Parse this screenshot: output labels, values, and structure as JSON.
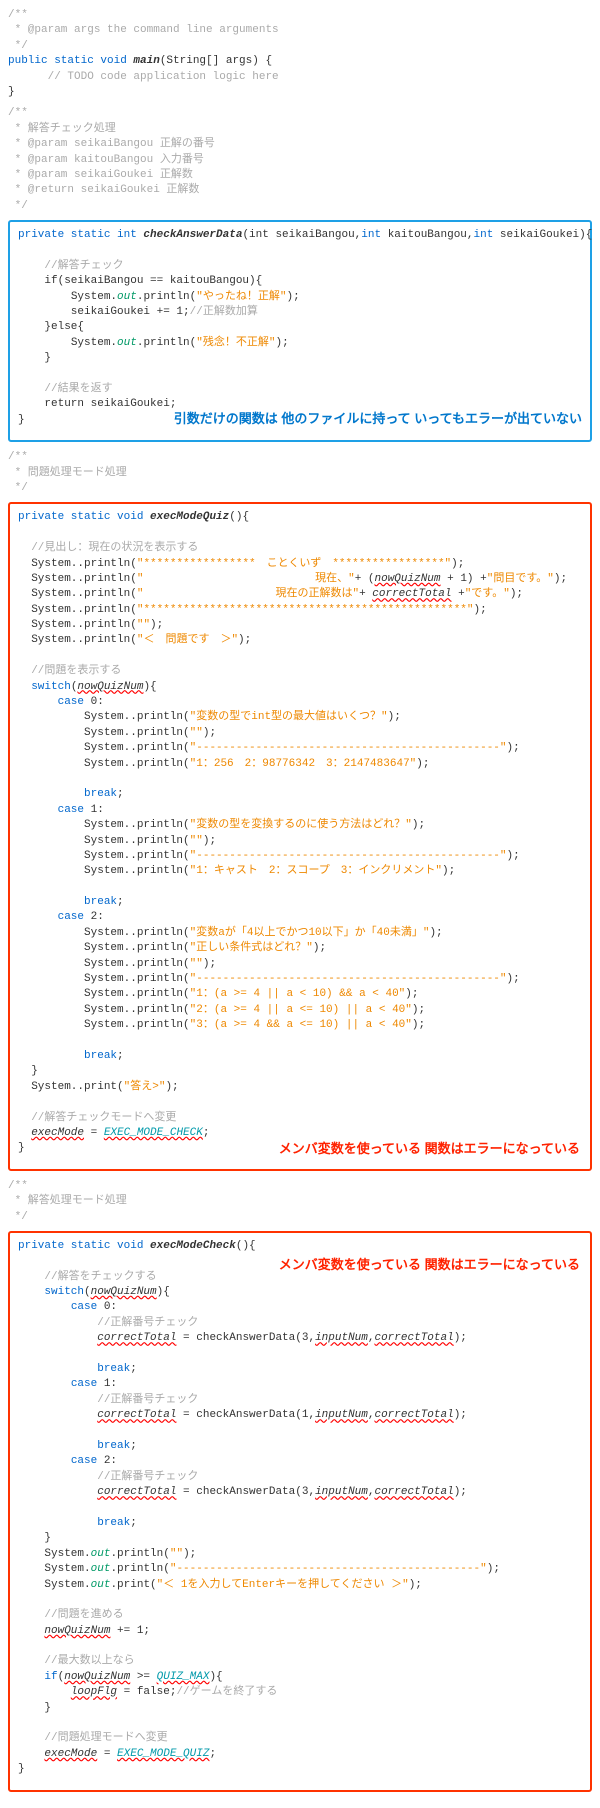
{
  "javadoc_main": {
    "l1": "/**",
    "l2": " * @param args the command line arguments",
    "l3": " */"
  },
  "main_method": {
    "sig_pre": "public static void ",
    "name": "main",
    "sig_post": "(String[] args) {",
    "body": "      // TODO code application logic here",
    "close": "}"
  },
  "javadoc_check": {
    "l1": "/**",
    "l2": " * 解答チェック処理",
    "l3": " * @param seikaiBangou 正解の番号",
    "l4": " * @param kaitouBangou 入力番号",
    "l5": " * @param seikaiGoukei 正解数",
    "l6": " * @return seikaiGoukei 正解数",
    "l7": " */"
  },
  "check_method": {
    "sig_pre": "private static int ",
    "name": "checkAnswerData",
    "sig_post_a": "(int seikaiBangou,",
    "sig_post_b": "int",
    "sig_post_c": " kaitouBangou,",
    "sig_post_d": " seikaiGoukei){",
    "c1": "    //解答チェック",
    "if": "    if(seikaiBangou == kaitouBangou){",
    "sys": "System",
    "out": "out",
    "println": "println",
    "s1": "\"やったね！正解\"",
    "inc": "        seikaiGoukei += 1;",
    "inc_c": "//正解数加算",
    "else": "    }else{",
    "s2": "\"残念！不正解\"",
    "close_if": "    }",
    "c2": "    //結果を返す",
    "ret": "    return seikaiGoukei;",
    "close": "}"
  },
  "annotation_blue": "引数だけの関数は\n他のファイルに持って\nいってもエラーが出ていない",
  "javadoc_quiz": {
    "l1": "/**",
    "l2": " * 問題処理モード処理",
    "l3": " */"
  },
  "quiz_method": {
    "sig_pre": "private static void ",
    "name": "execModeQuiz",
    "sig_post": "(){",
    "c1": "  //見出し：現在の状況を表示する",
    "s1": "\"*****************　ことくいず　*****************\"",
    "s2a": "\"                          現在、\"",
    "s2b": "+ (",
    "s2v": "nowQuizNum",
    "s2c": " + 1) +",
    "s2d": "\"問目です。\"",
    "s3a": "\"                    現在の正解数は\"",
    "s3b": "+ ",
    "s3v": "correctTotal",
    "s3c": " +",
    "s3d": "\"です。\"",
    "s4": "\"*************************************************\"",
    "s5": "\"\"",
    "s6": "\"＜　問題です　＞\"",
    "c2": "  //問題を表示する",
    "sw": "switch",
    "sw_var": "nowQuizNum",
    "case": "case",
    "c0": " 0:",
    "c1n": " 1:",
    "c2n": " 2:",
    "q0_1": "\"変数の型でint型の最大値はいくつ？\"",
    "q0_2": "\"\"",
    "q0_3": "\"----------------------------------------------\"",
    "q0_4": "\"1：256　2：98776342　3：2147483647\"",
    "q1_1": "\"変数の型を変換するのに使う方法はどれ？\"",
    "q1_2": "\"\"",
    "q1_3": "\"----------------------------------------------\"",
    "q1_4": "\"1：キャスト　2：スコープ　3：インクリメント\"",
    "q2_1": "\"変数aが「4以上でかつ10以下」か「40未満」\"",
    "q2_2": "\"正しい条件式はどれ？\"",
    "q2_3": "\"\"",
    "q2_4": "\"----------------------------------------------\"",
    "q2_5": "\"1：(a >= 4 || a < 10) && a < 40\"",
    "q2_6": "\"2：(a >= 4 || a <= 10) || a < 40\"",
    "q2_7": "\"3：(a >= 4 && a <= 10) || a < 40\"",
    "brk": "break",
    "ans": "\"答え>\"",
    "c3": "  //解答チェックモードへ変更",
    "exec_var": "execMode",
    "exec_val": "EXEC_MODE_CHECK",
    "close": "}"
  },
  "annotation_red1": "メンバ変数を使っている\n関数はエラーになっている",
  "javadoc_answer": {
    "l1": "/**",
    "l2": " * 解答処理モード処理",
    "l3": " */"
  },
  "answer_method": {
    "sig_pre": "private static void ",
    "name": "execModeCheck",
    "sig_post": "(){",
    "c1": "    //解答をチェックする",
    "sw": "switch",
    "sw_var": "nowQuizNum",
    "case": "case",
    "c0": " 0:",
    "c1n": " 1:",
    "c2n": " 2:",
    "cc": "//正解番号チェック",
    "ct": "correctTotal",
    "chk": " = checkAnswerData(",
    "a0": "3,",
    "a1": "1,",
    "a2": "3,",
    "inp": "inputNum",
    "cm": ",",
    "end": ");",
    "brk": "break",
    "empty": "\"\"",
    "dash": "\"----------------------------------------------\"",
    "prompt": "\"＜ 1を入力してEnterキーを押してください ＞\"",
    "c3": "    //問題を進める",
    "ad_var": "nowQuizNum",
    "ad_op": " += 1;",
    "c4": "    //最大数以上なら",
    "if": "if",
    "if_var": "nowQuizNum",
    "if_op": " >= ",
    "if_max": "QUIZ_MAX",
    "loop_var": "loopFlg",
    "loop_val": " = false;",
    "loop_c": "//ゲームを終了する",
    "c5": "    //問題処理モードへ変更",
    "exec_var": "execMode",
    "exec_val": "EXEC_MODE_QUIZ",
    "close": "}"
  },
  "annotation_red2": "メンバ変数を使っている\n関数はエラーになっている"
}
